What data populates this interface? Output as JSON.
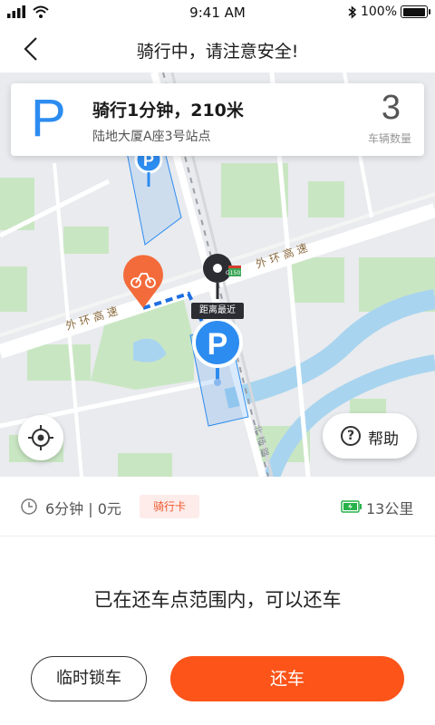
{
  "status_bar": {
    "time": "9:41 AM",
    "battery_percent": "100%",
    "battery_level": 1.0
  },
  "nav": {
    "title": "骑行中，请注意安全!",
    "back_icon": "chevron-left-icon"
  },
  "map": {
    "road_label_upper": "外 环 高 速",
    "road_label_lower": "外 环 高 速",
    "road_label_vertical": "北 杨 路",
    "nearest_tag": "距离最近",
    "shield_label": "G1501",
    "parking_icon": "parking-pin-icon",
    "bike_icon": "bike-pin-icon",
    "colors": {
      "water": "#a8d4ef",
      "green": "#c9e6c3",
      "road": "#ffffff",
      "parking": "#2d8cf0",
      "bike_pin": "#f36b3b"
    }
  },
  "info_card": {
    "title": "骑行1分钟，210米",
    "station": "陆地大厦A座3号站点",
    "letter": "P",
    "count": "3",
    "count_label": "车辆数量"
  },
  "controls": {
    "locate_icon": "locate-icon",
    "help_label": "帮助"
  },
  "ride": {
    "time_and_cost": "6分钟 | 0元",
    "card_badge": "骑行卡",
    "range": "13公里"
  },
  "message": "已在还车点范围内，可以还车",
  "buttons": {
    "temp_lock": "临时锁车",
    "return": "还车",
    "accent": "#fc5419"
  }
}
